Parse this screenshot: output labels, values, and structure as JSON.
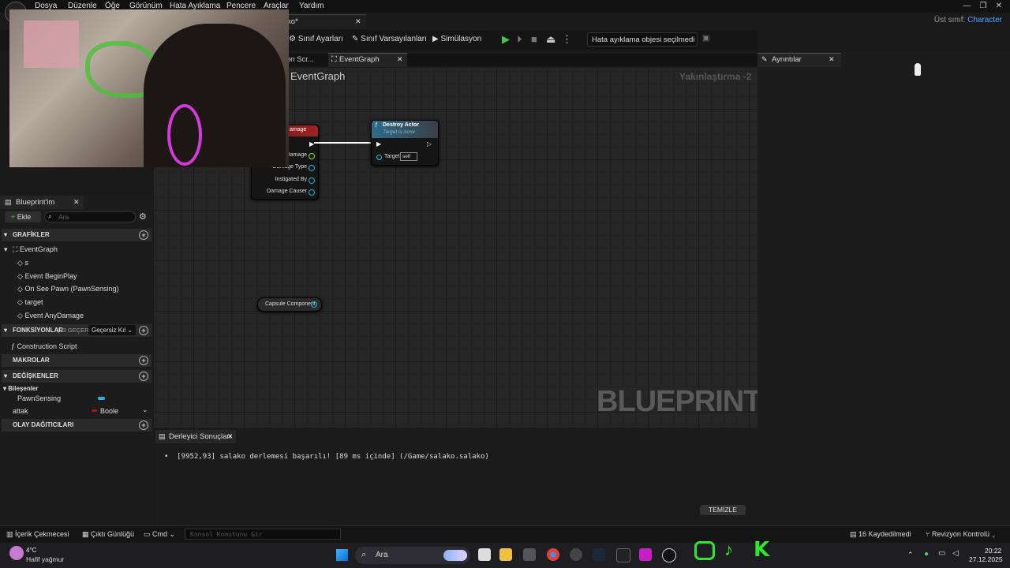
{
  "menu": [
    "Dosya",
    "Düzenle",
    "Öğe",
    "Görünüm",
    "Hata Ayıklama",
    "Pencere",
    "Araçlar",
    "Yardım"
  ],
  "title_fragment": "ko*",
  "parent_class": {
    "label": "Üst sınıf:",
    "value": "Character"
  },
  "toolbar": {
    "class_settings": "Sınıf Ayarları",
    "class_defaults": "Sınıf Varsayılanları",
    "simulation": "Simülasyon",
    "debug_object": "Hata ayıklama objesi seçilmedi"
  },
  "tabs": {
    "construction": "on Scr...",
    "eventgraph": "EventGraph",
    "details": "Ayrıntılar"
  },
  "graph": {
    "title": "EventGraph",
    "zoom": "Yakınlaştırma -2",
    "watermark": "BLUEPRINT",
    "event_header": "amage",
    "event_pins": [
      "Damage",
      "Damage Type",
      "Instigated By",
      "Damage Causer"
    ],
    "destroy": {
      "title": "Destroy Actor",
      "subtitle": "Target is Actor",
      "target_label": "Target",
      "target_value": "self"
    },
    "capsule": "Capsule Component"
  },
  "my_blueprint": {
    "title": "Blueprint'im",
    "add": "Ekle",
    "search_placeholder": "Ara",
    "sections": {
      "graphs": "GRAFİKLER",
      "functions": "FONKSİYONLAR",
      "functions_count": "(33 GEÇERSİ",
      "functions_filter": "Geçersiz Kıl",
      "macros": "MAKROLAR",
      "variables": "DEĞİŞKENLER",
      "components": "Bileşenler",
      "dispatchers": "OLAY DAĞITICILARI"
    },
    "eventgraph": "EventGraph",
    "events": [
      "s",
      "Event BeginPlay",
      "On See Pawn (PawnSensing)",
      "target",
      "Event AnyDamage"
    ],
    "construction_script": "Construction Script",
    "component_item": "PawnSensing",
    "variable": {
      "name": "attak",
      "type": "Boole"
    }
  },
  "compiler": {
    "tab": "Derleyici Sonuçları",
    "message": "[9952,93] salako derlemesi başarılı! [89 ms içinde] (/Game/salako.salako)",
    "clear": "TEMİZLE"
  },
  "status": {
    "content_drawer": "İçerik Çekmecesi",
    "output_log": "Çıktı Günlüğü",
    "cmd": "Cmd",
    "console_placeholder": "Konsol Komutunu Gir",
    "saved": "16 Kaydedilmedi",
    "revision": "Revizyon Kontrolü"
  },
  "taskbar": {
    "weather_temp": "4°C",
    "weather_desc": "Hafif yağmur",
    "search": "Ara",
    "time": "20:22",
    "date": "27.12.2025"
  },
  "colors": {
    "accent": "#4fa3ff",
    "play": "#3ec93e",
    "exec_wire": "#ffffff",
    "bool": "#b80f0f",
    "obj": "#1ab7e8"
  }
}
